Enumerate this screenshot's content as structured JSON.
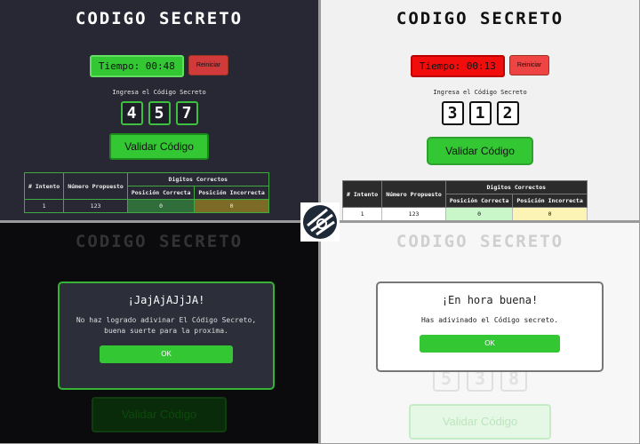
{
  "tl": {
    "title": "CODIGO SECRETO",
    "timer": "Tiempo: 00:48",
    "reset": "Reiniciar",
    "prompt": "Ingresa el Código Secreto",
    "digits": [
      "4",
      "5",
      "7"
    ],
    "validate": "Validar Código",
    "table": {
      "h_intento": "# Intento",
      "h_numero": "Número Propuesto",
      "h_digitos": "Digitos Correctos",
      "h_pos_ok": "Posición Correcta",
      "h_pos_bad": "Posición Incorrecta",
      "row": {
        "intento": "1",
        "numero": "123",
        "ok": "0",
        "bad": "0"
      }
    }
  },
  "tr": {
    "title": "CODIGO SECRETO",
    "timer": "Tiempo: 00:13",
    "reset": "Reiniciar",
    "prompt": "Ingresa el Código Secreto",
    "digits": [
      "3",
      "1",
      "2"
    ],
    "validate": "Validar Código",
    "table": {
      "h_intento": "# Intento",
      "h_numero": "Número Propuesto",
      "h_digitos": "Digitos Correctos",
      "h_pos_ok": "Posición Correcta",
      "h_pos_bad": "Posición Incorrecta",
      "row": {
        "intento": "1",
        "numero": "123",
        "ok": "0",
        "bad": "0"
      }
    }
  },
  "bl": {
    "title": "CODIGO SECRETO",
    "modal_title": "¡JajAjAJjJA!",
    "modal_text": "No haz logrado adivinar El Código Secreto, buena suerte para la proxima.",
    "ok": "OK",
    "validate": "Validar Código"
  },
  "br": {
    "title": "CODIGO SECRETO",
    "modal_title": "¡En hora buena!",
    "modal_text": "Has adivinado el Código secreto.",
    "ok": "OK",
    "digits": [
      "5",
      "3",
      "8"
    ],
    "validate": "Validar Código"
  },
  "colors": {
    "accent_green": "#33c733",
    "alert_red": "#f20d0d"
  },
  "icons": {
    "center_logo": "brand-logo-icon"
  }
}
